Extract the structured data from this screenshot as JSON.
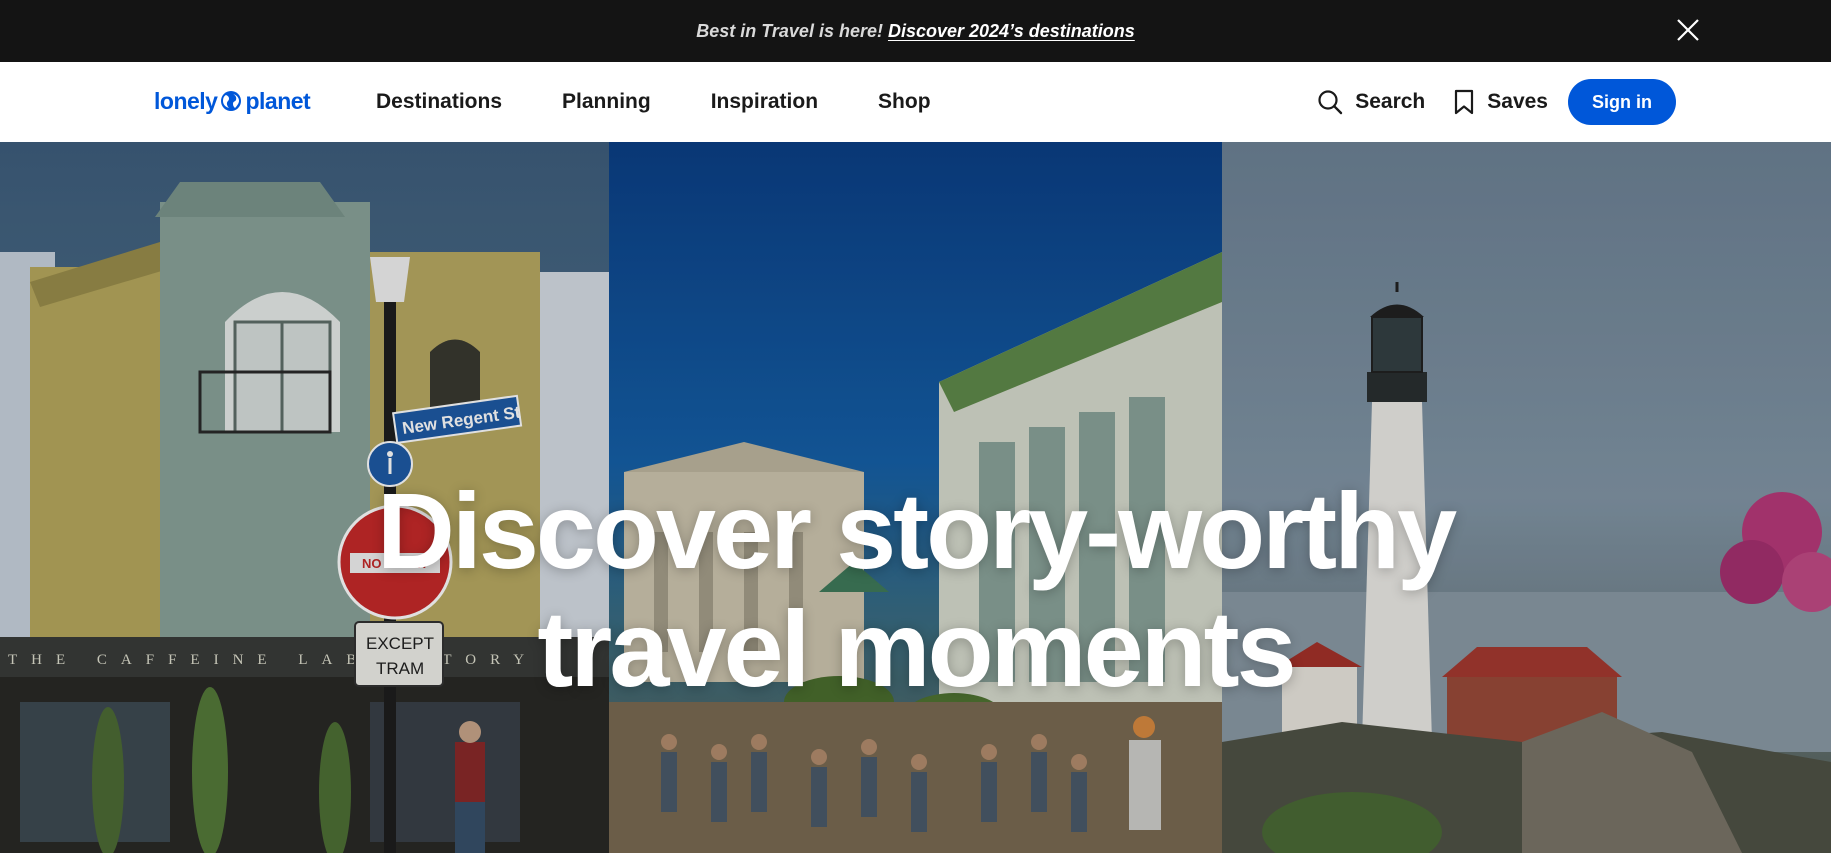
{
  "announcement": {
    "prefix": "Best in Travel is here!",
    "link_text": "Discover 2024’s destinations"
  },
  "header": {
    "logo_left": "lonely",
    "logo_right": "planet",
    "nav": [
      {
        "label": "Destinations"
      },
      {
        "label": "Planning"
      },
      {
        "label": "Inspiration"
      },
      {
        "label": "Shop"
      }
    ],
    "search_label": "Search",
    "saves_label": "Saves",
    "signin_label": "Sign in"
  },
  "hero": {
    "title_line1": "Discover story-worthy",
    "title_line2": "travel moments",
    "signs": {
      "street": "New Regent St",
      "no_entry": "NO ENTRY",
      "except_line1": "EXCEPT",
      "except_line2": "TRAM",
      "cafe": "THE CAFFEINE LABORATORY"
    }
  },
  "colors": {
    "brand": "#0057d9",
    "announcement_bg": "#141414"
  },
  "icons": [
    "close-icon",
    "globe-icon",
    "search-icon",
    "bookmark-icon"
  ]
}
